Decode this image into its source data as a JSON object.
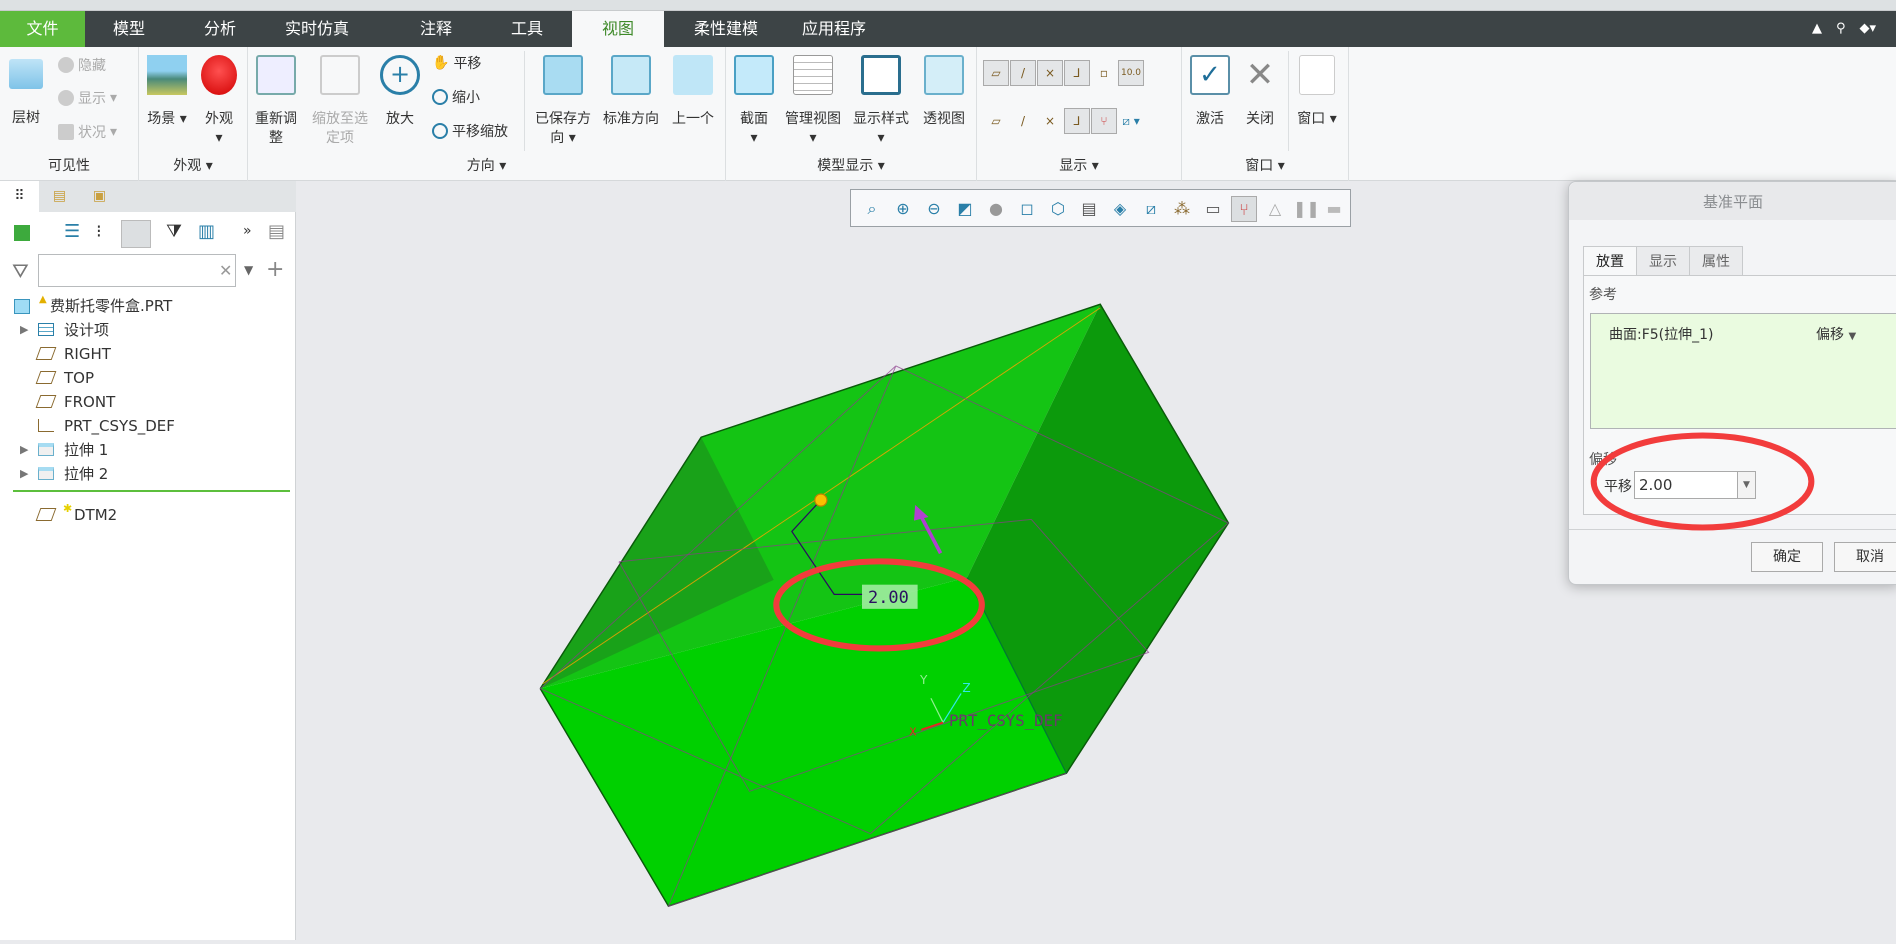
{
  "ribbon_tabs": [
    "文件",
    "模型",
    "分析",
    "实时仿真",
    "注释",
    "工具",
    "视图",
    "柔性建模",
    "应用程序"
  ],
  "active_tab": "视图",
  "ribbon": {
    "visibility": {
      "label": "可见性",
      "layer_tree": "层树",
      "hide": "隐藏",
      "show": "显示",
      "status": "状况"
    },
    "appearance": {
      "label": "外观",
      "scene": "场景",
      "appearance": "外观"
    },
    "orientation": {
      "label": "方向",
      "refit": "重新调整",
      "zoom_to_selected": "缩放至选定项",
      "zoom_in": "放大",
      "pan": "平移",
      "zoom_out": "缩小",
      "pan_zoom": "平移缩放",
      "saved_orientations": "已保存方向",
      "standard_orientation": "标准方向",
      "previous": "上一个"
    },
    "model_display": {
      "label": "模型显示",
      "section": "截面",
      "manage_views": "管理视图",
      "display_style": "显示样式",
      "perspective": "透视图"
    },
    "show": {
      "label": "显示",
      "annotation_value": "10.0"
    },
    "window": {
      "label": "窗口",
      "activate": "激活",
      "close": "关闭",
      "window": "窗口"
    }
  },
  "model_tree": {
    "filter_placeholder": "",
    "root": "费斯托零件盒.PRT",
    "items": [
      {
        "label": "设计项",
        "expandable": true,
        "icon": "design-items-icon"
      },
      {
        "label": "RIGHT",
        "icon": "datum-plane-icon"
      },
      {
        "label": "TOP",
        "icon": "datum-plane-icon"
      },
      {
        "label": "FRONT",
        "icon": "datum-plane-icon"
      },
      {
        "label": "PRT_CSYS_DEF",
        "icon": "csys-icon"
      },
      {
        "label": "拉伸 1",
        "expandable": true,
        "icon": "extrude-icon"
      },
      {
        "label": "拉伸 2",
        "expandable": true,
        "icon": "extrude-icon"
      }
    ],
    "inserting": {
      "label": "DTM2",
      "icon": "datum-plane-icon"
    }
  },
  "viewport": {
    "dimension": "2.00",
    "csys_label": "PRT_CSYS_DEF",
    "axes": {
      "x": "X",
      "y": "Y",
      "z": "Z"
    },
    "model_color": "#00d000"
  },
  "dialog": {
    "title": "基准平面",
    "tabs": [
      "放置",
      "显示",
      "属性"
    ],
    "active_tab": "放置",
    "references_label": "参考",
    "reference": "曲面:F5(拉伸_1)",
    "reference_constraint": "偏移",
    "offset_label": "偏移",
    "translation_label": "平移",
    "translation_value": "2.00",
    "ok": "确定",
    "cancel": "取消"
  },
  "annotation_color": "#f03c3c"
}
